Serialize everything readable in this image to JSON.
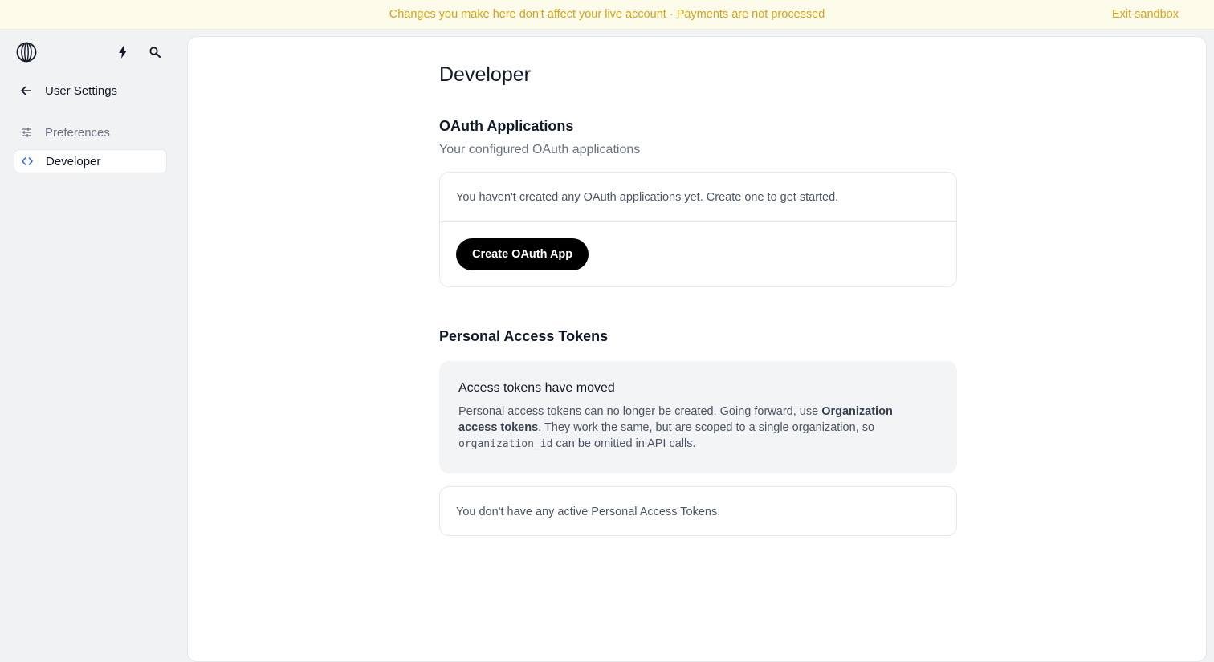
{
  "banner": {
    "message": "Changes you make here don't affect your live account · Payments are not processed",
    "exit_label": "Exit sandbox"
  },
  "colors": {
    "banner_text": "#d4a418",
    "banner_bg": "#fdfbe9",
    "accent_blue": "#2563eb",
    "button_bg": "#000000"
  },
  "sidebar": {
    "logo_icon": "globe-logo-icon",
    "quick_action_icon": "bolt-icon",
    "search_icon": "search-icon",
    "back_label": "User Settings",
    "items": [
      {
        "label": "Preferences",
        "icon": "sliders-icon",
        "active": false
      },
      {
        "label": "Developer",
        "icon": "code-icon",
        "active": true
      }
    ]
  },
  "main": {
    "title": "Developer",
    "oauth": {
      "title": "OAuth Applications",
      "subtitle": "Your configured OAuth applications",
      "empty_text": "You haven't created any OAuth applications yet. Create one to get started.",
      "create_button": "Create OAuth App"
    },
    "pat": {
      "title": "Personal Access Tokens",
      "notice": {
        "title": "Access tokens have moved",
        "text_before": "Personal access tokens can no longer be created. Going forward, use ",
        "bold": "Organization access tokens",
        "text_middle": ". They work the same, but are scoped to a single organization, so ",
        "code": "organization_id",
        "text_after": " can be omitted in API calls."
      },
      "empty_text": "You don't have any active Personal Access Tokens."
    }
  }
}
